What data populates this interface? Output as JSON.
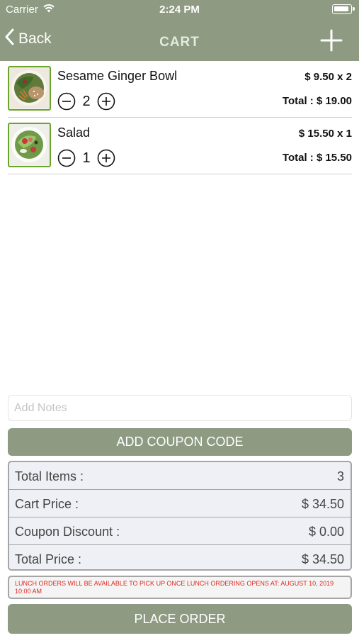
{
  "status_bar": {
    "carrier": "Carrier",
    "time": "2:24 PM"
  },
  "nav": {
    "back_label": "Back",
    "title": "CART"
  },
  "cart": {
    "items": [
      {
        "name": "Sesame Ginger Bowl",
        "quantity": "2",
        "unit_price": "$ 9.50 x 2",
        "total": "Total : $ 19.00"
      },
      {
        "name": "Salad",
        "quantity": "1",
        "unit_price": "$ 15.50 x 1",
        "total": "Total : $ 15.50"
      }
    ]
  },
  "notes": {
    "placeholder": "Add Notes",
    "value": ""
  },
  "coupon": {
    "button_label": "ADD COUPON CODE"
  },
  "summary": {
    "rows": [
      {
        "label": "Total Items :",
        "value": "3"
      },
      {
        "label": "Cart Price :",
        "value": "$ 34.50"
      },
      {
        "label": "Coupon Discount :",
        "value": "$ 0.00"
      },
      {
        "label": "Total Price :",
        "value": "$ 34.50"
      }
    ]
  },
  "notice": {
    "text": "LUNCH ORDERS WILL BE AVAILABLE TO PICK UP ONCE LUNCH ORDERING OPENS AT: AUGUST 10, 2019 10:00 AM"
  },
  "place_order": {
    "button_label": "PLACE ORDER"
  },
  "colors": {
    "accent": "#8e9a81",
    "thumb_border": "#6ba32d",
    "notice_text": "#e0281e",
    "summary_bg": "#eef0f6"
  }
}
